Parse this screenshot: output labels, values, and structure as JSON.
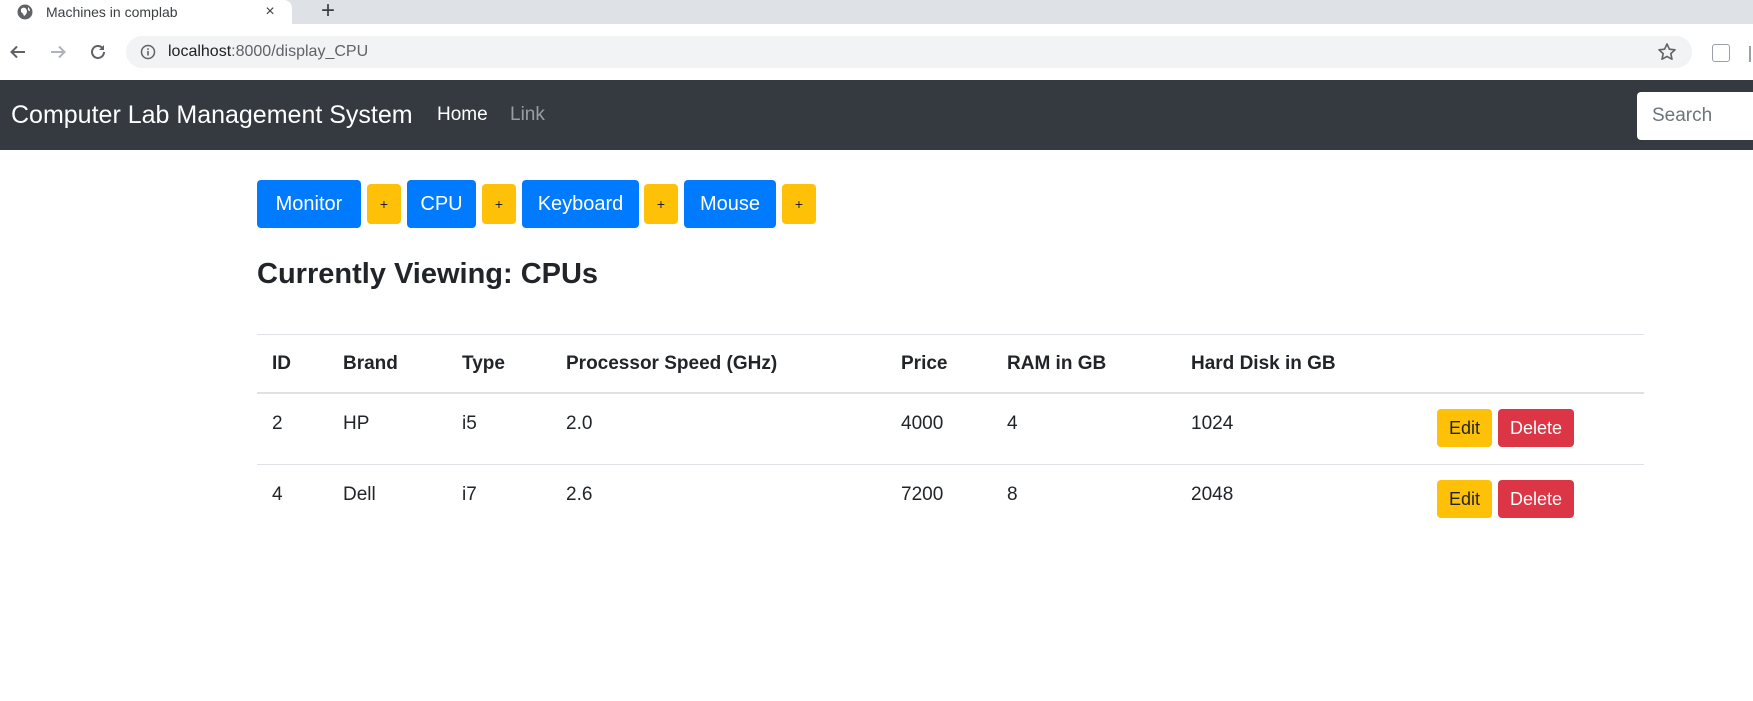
{
  "browser": {
    "tab_title": "Machines in complab",
    "tab_close": "×",
    "new_tab": "+",
    "url_host": "localhost",
    "url_path": ":8000/display_CPU"
  },
  "navbar": {
    "brand": "Computer Lab Management System",
    "links": [
      "Home",
      "Link"
    ],
    "search_placeholder": "Search"
  },
  "categories": [
    {
      "label": "Monitor",
      "add_label": "+"
    },
    {
      "label": "CPU",
      "add_label": "+"
    },
    {
      "label": "Keyboard",
      "add_label": "+"
    },
    {
      "label": "Mouse",
      "add_label": "+"
    }
  ],
  "heading": {
    "prefix": "Currently Viewing:",
    "value": "CPUs"
  },
  "table": {
    "headers": [
      "ID",
      "Brand",
      "Type",
      "Processor Speed (GHz)",
      "Price",
      "RAM in GB",
      "Hard Disk in GB"
    ],
    "rows": [
      {
        "id": "2",
        "brand": "HP",
        "type": "i5",
        "speed": "2.0",
        "price": "4000",
        "ram": "4",
        "hdd": "1024"
      },
      {
        "id": "4",
        "brand": "Dell",
        "type": "i7",
        "speed": "2.6",
        "price": "7200",
        "ram": "8",
        "hdd": "2048"
      }
    ],
    "edit_label": "Edit",
    "delete_label": "Delete"
  },
  "colors": {
    "navbar_bg": "#343a40",
    "primary": "#007bff",
    "warning": "#ffc107",
    "danger": "#dc3545"
  }
}
